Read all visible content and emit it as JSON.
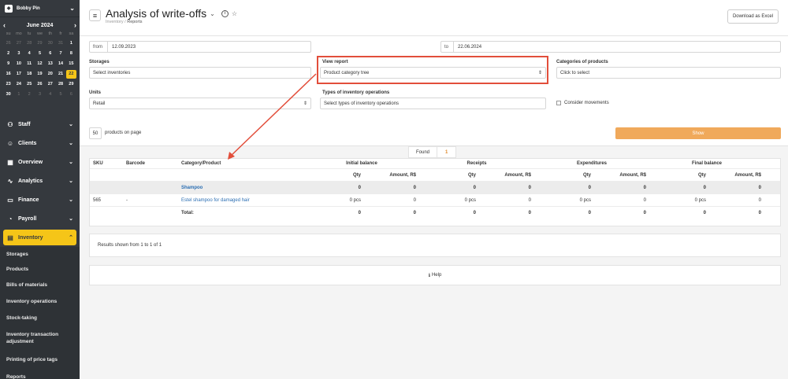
{
  "user": {
    "name": "Bobby Pin"
  },
  "calendar": {
    "month": "June 2024",
    "prev": "‹",
    "next": "›",
    "dow": [
      "su",
      "mo",
      "tu",
      "we",
      "th",
      "fr",
      "sa"
    ],
    "weeks": [
      [
        "26",
        "27",
        "28",
        "29",
        "30",
        "31",
        "1"
      ],
      [
        "2",
        "3",
        "4",
        "5",
        "6",
        "7",
        "8"
      ],
      [
        "9",
        "10",
        "11",
        "12",
        "13",
        "14",
        "15"
      ],
      [
        "16",
        "17",
        "18",
        "19",
        "20",
        "21",
        "22"
      ],
      [
        "23",
        "24",
        "25",
        "26",
        "27",
        "28",
        "29"
      ],
      [
        "30",
        "1",
        "2",
        "3",
        "4",
        "5",
        "6"
      ]
    ],
    "today": "22"
  },
  "nav": {
    "items": [
      {
        "label": "Staff",
        "icon": "staff-icon"
      },
      {
        "label": "Clients",
        "icon": "clients-icon"
      },
      {
        "label": "Overview",
        "icon": "overview-icon"
      },
      {
        "label": "Analytics",
        "icon": "analytics-icon"
      },
      {
        "label": "Finance",
        "icon": "finance-icon"
      },
      {
        "label": "Payroll",
        "icon": "payroll-icon"
      }
    ],
    "active": {
      "label": "Inventory",
      "icon": "inventory-icon"
    },
    "subitems": [
      "Storages",
      "Products",
      "Bills of materials",
      "Inventory operations",
      "Stock-taking",
      "Inventory transaction adjustment",
      "Printing of price tags",
      "Reports"
    ]
  },
  "header": {
    "title": "Analysis of write-offs",
    "breadcrumb": [
      "Inventory",
      "Reports"
    ],
    "download": "Download as Excel"
  },
  "filters": {
    "from_label": "from",
    "from_value": "12.09.2023",
    "to_label": "to",
    "to_value": "22.06.2024",
    "storages_label": "Storages",
    "storages_value": "Select inventories",
    "view_label": "View report",
    "view_value": "Product category tree",
    "categories_label": "Categories of products",
    "categories_value": "Click to select",
    "units_label": "Units",
    "units_value": "Retail",
    "types_label": "Types of inventory operations",
    "types_value": "Select types of inventory operations",
    "consider": "Consider movements",
    "per_page": "50",
    "per_page_label": "products on page",
    "show": "Show"
  },
  "found": {
    "label": "Found",
    "count": "1"
  },
  "table": {
    "headers": {
      "sku": "SKU",
      "barcode": "Barcode",
      "cat": "Category/Product",
      "initial": "Initial balance",
      "receipts": "Receipts",
      "expenditures": "Expenditures",
      "final": "Final balance"
    },
    "sub": {
      "qty": "Qty",
      "amount": "Amount, R$"
    },
    "category_row": {
      "name": "Shampoo",
      "vals": [
        "0",
        "0",
        "0",
        "0",
        "0",
        "0",
        "0",
        "0"
      ]
    },
    "product_row": {
      "sku": "565",
      "barcode": "-",
      "name": "Estel shampoo for damaged hair",
      "vals": [
        "0 pcs",
        "0",
        "0 pcs",
        "0",
        "0 pcs",
        "0",
        "0 pcs",
        "0"
      ]
    },
    "total_row": {
      "label": "Total:",
      "vals": [
        "0",
        "0",
        "0",
        "0",
        "0",
        "0",
        "0",
        "0"
      ]
    }
  },
  "results_text": "Results shown from 1 to 1 of 1",
  "help": "Help",
  "colors": {
    "sidebar": "#35393e",
    "accent": "#f5c518",
    "show": "#f0a95b",
    "highlight": "#e24e3b",
    "link": "#2c6fb3"
  }
}
